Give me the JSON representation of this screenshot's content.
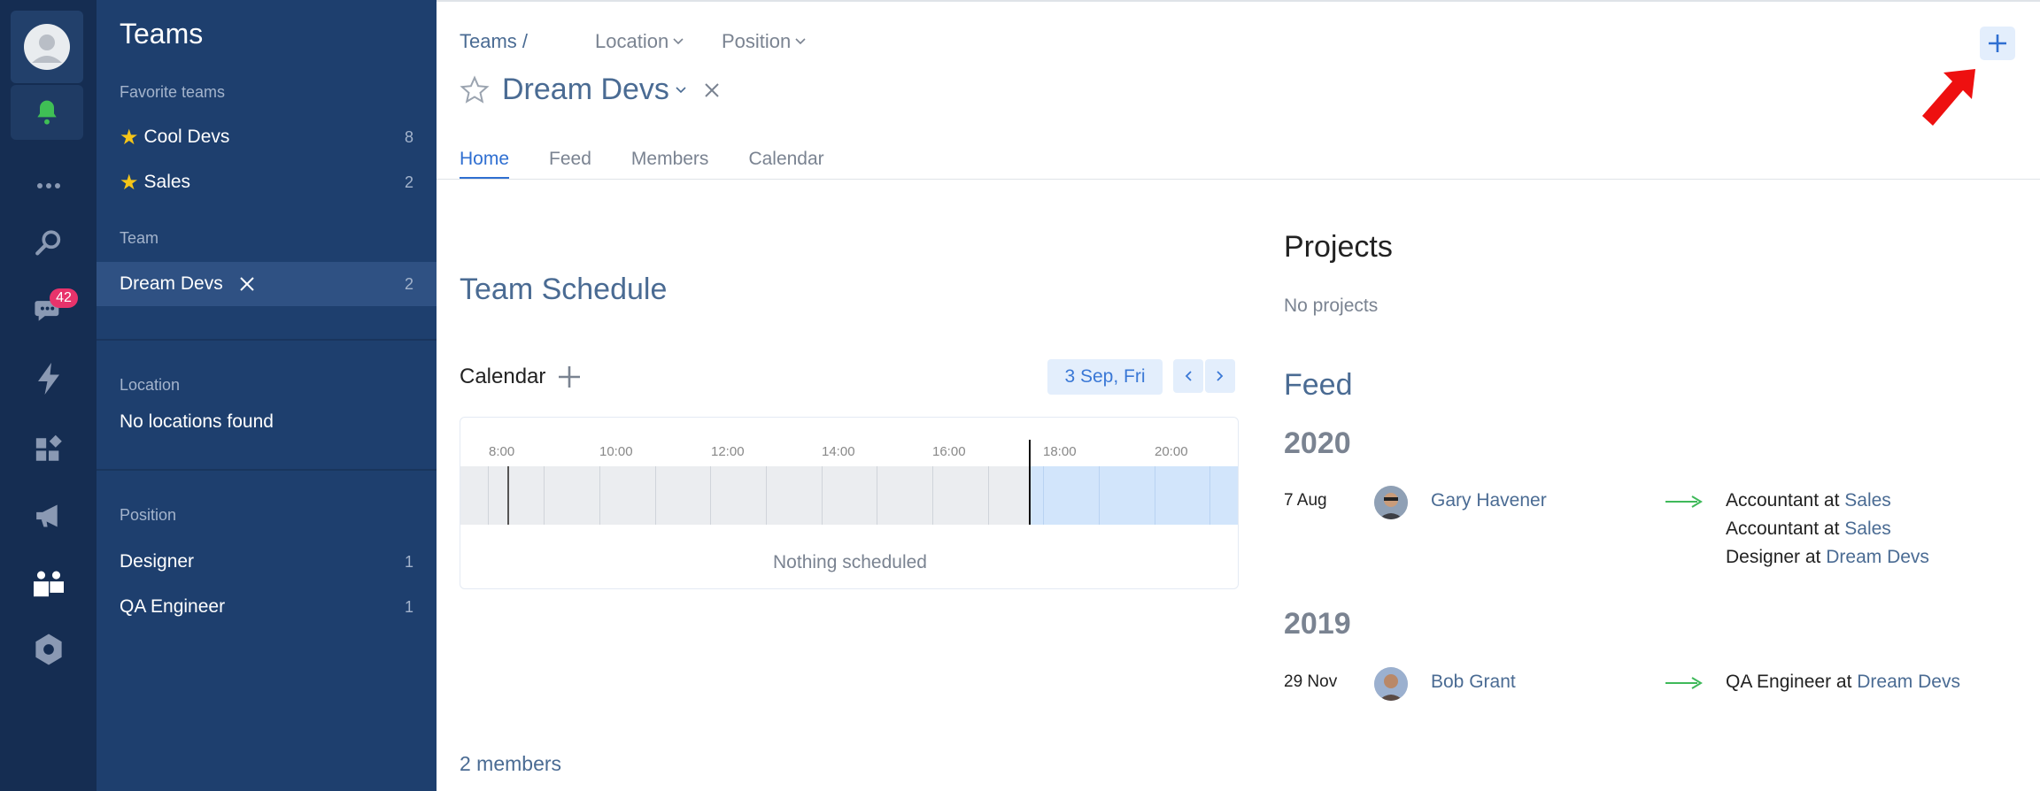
{
  "rail": {
    "notifications_badge": "42",
    "icons": [
      "avatar",
      "bell-icon",
      "more-icon",
      "search-icon",
      "chat-icon",
      "lightning-icon",
      "widgets-icon",
      "megaphone-icon",
      "teams-icon",
      "settings-icon"
    ]
  },
  "sidebar": {
    "title": "Teams",
    "favorites_label": "Favorite teams",
    "favorites": [
      {
        "label": "Cool Devs",
        "count": "8"
      },
      {
        "label": "Sales",
        "count": "2"
      }
    ],
    "team_label": "Team",
    "team": {
      "label": "Dream Devs",
      "count": "2"
    },
    "location_label": "Location",
    "location_empty": "No locations found",
    "position_label": "Position",
    "positions": [
      {
        "label": "Designer",
        "count": "1"
      },
      {
        "label": "QA Engineer",
        "count": "1"
      }
    ]
  },
  "header": {
    "breadcrumb": "Teams /",
    "location_filter": "Location",
    "position_filter": "Position",
    "team_name": "Dream Devs"
  },
  "tabs": [
    "Home",
    "Feed",
    "Members",
    "Calendar"
  ],
  "schedule": {
    "title": "Team Schedule",
    "calendar_label": "Calendar",
    "date": "3 Sep, Fri",
    "ticks": [
      "8:00",
      "10:00",
      "12:00",
      "14:00",
      "16:00",
      "18:00",
      "20:00"
    ],
    "empty": "Nothing scheduled",
    "members_link": "2 members"
  },
  "projects": {
    "title": "Projects",
    "empty": "No projects"
  },
  "feed": {
    "title": "Feed",
    "groups": [
      {
        "year": "2020",
        "entries": [
          {
            "date": "7 Aug",
            "name": "Gary Havener",
            "lines": [
              {
                "text": "Accountant at ",
                "link": "Sales"
              },
              {
                "text": "Accountant at ",
                "link": "Sales"
              },
              {
                "text": "Designer at ",
                "link": "Dream Devs"
              }
            ]
          }
        ]
      },
      {
        "year": "2019",
        "entries": [
          {
            "date": "29 Nov",
            "name": "Bob Grant",
            "lines": [
              {
                "text": "QA Engineer at ",
                "link": "Dream Devs"
              }
            ]
          }
        ]
      }
    ]
  },
  "colors": {
    "rail": "#152d52",
    "sidebar": "#1e3f6e",
    "accent": "#2f6fd1",
    "star": "#f5c518",
    "badge": "#e8336b",
    "arrow": "#3fb95a"
  }
}
